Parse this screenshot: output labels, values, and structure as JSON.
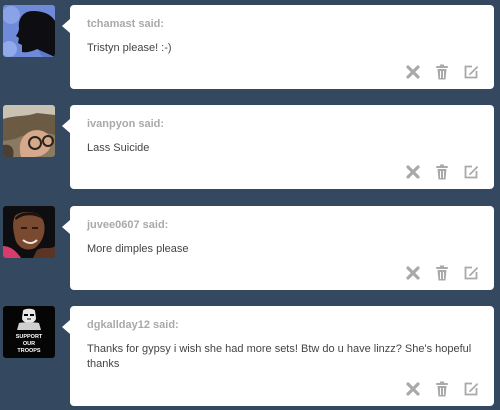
{
  "feed": {
    "items": [
      {
        "asker_line": "tchamast said:",
        "question": "Tristyn please! :-)",
        "avatar": "silhouette-avatar",
        "actions": [
          "delete-icon",
          "trash-icon",
          "edit-icon"
        ]
      },
      {
        "asker_line": "ivanpyon said:",
        "question": "Lass Suicide",
        "avatar": "photo-avatar",
        "actions": [
          "delete-icon",
          "trash-icon",
          "edit-icon"
        ]
      },
      {
        "asker_line": "juvee0607 said:",
        "question": "More dimples please",
        "avatar": "photo-avatar",
        "actions": [
          "delete-icon",
          "trash-icon",
          "edit-icon"
        ]
      },
      {
        "asker_line": "dgkallday12 said:",
        "question": "Thanks for gypsy i wish she had more sets! Btw do u have linzz? She's hopeful thanks",
        "avatar": "support-our-troops-avatar",
        "avatar_text": [
          "SUPPORT",
          "OUR",
          "TROOPS"
        ],
        "actions": [
          "delete-icon",
          "trash-icon",
          "edit-icon"
        ]
      }
    ]
  },
  "colors": {
    "background": "#34485f",
    "card": "#ffffff",
    "asker_text": "#a9a9a9",
    "question_text": "#444444",
    "icon": "#a9a9a9"
  }
}
